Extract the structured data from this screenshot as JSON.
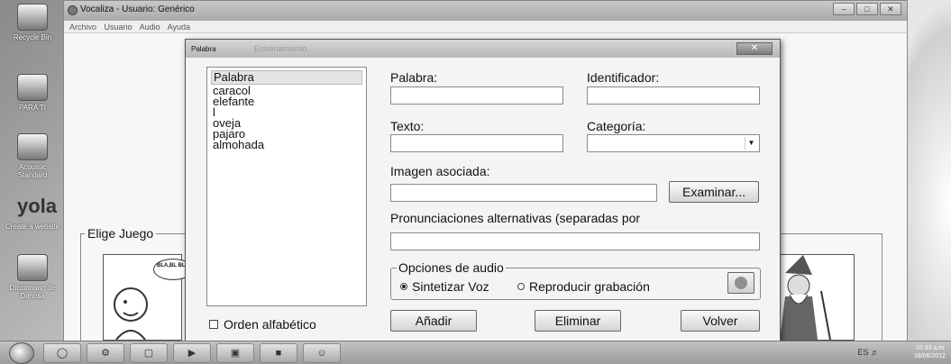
{
  "app": {
    "title": "Vocaliza - Usuario: Genérico",
    "menu": [
      "Archivo",
      "Usuario",
      "Audio",
      "Ayuda"
    ],
    "window_controls": [
      "–",
      "□",
      "✕"
    ]
  },
  "desktop_icons": [
    {
      "label": "Recycle Bin",
      "icon": "recycle-bin-icon"
    },
    {
      "label": "PARA TI",
      "icon": "folder-icon"
    },
    {
      "label": "Acoustic Standard",
      "icon": "music-icon"
    },
    {
      "label": "Create a website",
      "icon": "yola-icon"
    },
    {
      "label": "Diccionario de Danosa",
      "icon": "books-icon"
    }
  ],
  "main": {
    "group_label": "Elige Juego",
    "bubble_text": "BLA,BL BLA"
  },
  "dialog": {
    "title": "Palabra",
    "faded_title": "Entrenamiento",
    "close_label": "✕",
    "list_header": "Palabra",
    "words": [
      "caracol",
      "elefante",
      "l",
      "oveja",
      "pajaro",
      "almohada"
    ],
    "sort_checkbox_label": "Orden alfabético",
    "sort_checked": false,
    "fields": {
      "palabra_label": "Palabra:",
      "palabra_value": "",
      "identificador_label": "Identificador:",
      "identificador_value": "",
      "texto_label": "Texto:",
      "texto_value": "",
      "categoria_label": "Categoría:",
      "categoria_value": "",
      "imagen_label": "Imagen asociada:",
      "imagen_value": "",
      "pronunciaciones_label": "Pronunciaciones alternativas (separadas por",
      "pronunciaciones_value": ""
    },
    "examinar_label": "Examinar...",
    "audio_group_label": "Opciones de audio",
    "audio_options": [
      {
        "label": "Sintetizar Voz",
        "selected": true
      },
      {
        "label": "Reproducir grabación",
        "selected": false
      }
    ],
    "buttons": {
      "add": "Añadir",
      "delete": "Eliminar",
      "back": "Volver"
    }
  },
  "taskbar": {
    "time": "10:33 a.m.",
    "date": "18/06/2012",
    "lang": "ES"
  }
}
